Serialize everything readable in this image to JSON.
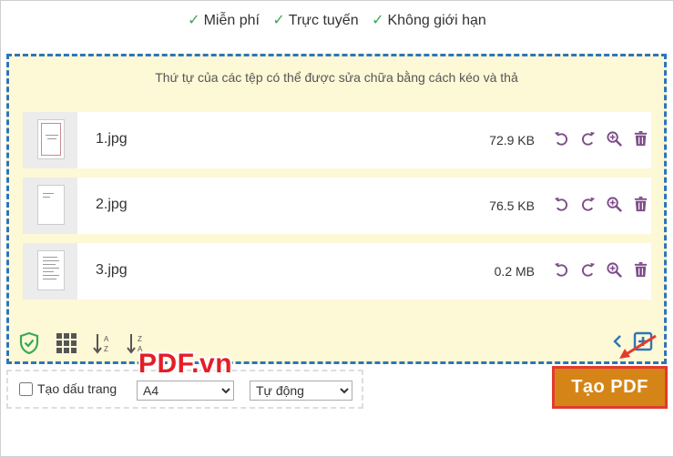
{
  "features": [
    "Miễn phí",
    "Trực tuyến",
    "Không giới hạn"
  ],
  "check_glyph": "✓",
  "dropzone": {
    "hint": "Thứ tự của các tệp có thể được sửa chữa bằng cách kéo và thả"
  },
  "files": [
    {
      "name": "1.jpg",
      "size": "72.9 KB"
    },
    {
      "name": "2.jpg",
      "size": "76.5 KB"
    },
    {
      "name": "3.jpg",
      "size": "0.2 MB"
    }
  ],
  "file_actions": [
    "rotate-left-icon",
    "rotate-right-icon",
    "zoom-icon",
    "trash-icon"
  ],
  "toolbar": {
    "icons": [
      "shield-check-icon",
      "grid-icon",
      "sort-az-icon",
      "sort-za-icon",
      "chevron-left-icon",
      "add-file-icon"
    ]
  },
  "options": {
    "bookmark_label": "Tạo dấu trang",
    "page_size": "A4",
    "orientation": "Tự động"
  },
  "create_button": "Tạo PDF",
  "watermark": "PDF.vn",
  "colors": {
    "accent_blue": "#2d76b8",
    "dropzone_bg": "#fdf8d6",
    "button_bg": "#d58517",
    "highlight_red": "#e23b2e",
    "icon_purple": "#7e4d8a",
    "shield_green": "#3aa856"
  }
}
